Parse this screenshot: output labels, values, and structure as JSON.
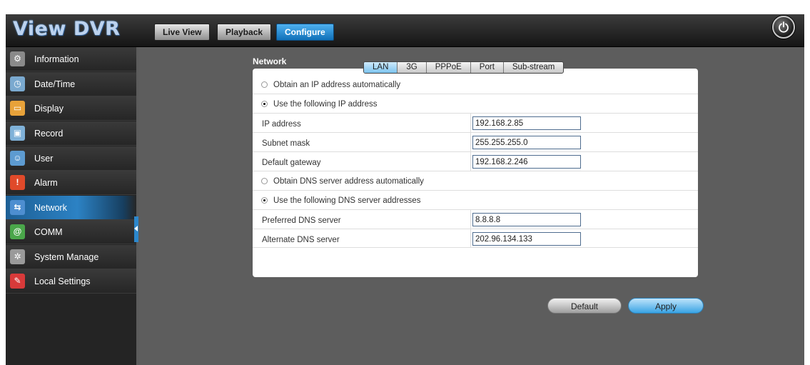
{
  "app": {
    "logo": "View DVR"
  },
  "topnav": {
    "live_view": "Live View",
    "playback": "Playback",
    "configure": "Configure"
  },
  "sidebar": {
    "items": [
      {
        "label": "Information",
        "icon": "gear-icon",
        "color": "#8a8a8a"
      },
      {
        "label": "Date/Time",
        "icon": "clock-icon",
        "color": "#7aa9cf"
      },
      {
        "label": "Display",
        "icon": "monitor-icon",
        "color": "#e8a23a"
      },
      {
        "label": "Record",
        "icon": "record-icon",
        "color": "#7fb1d8"
      },
      {
        "label": "User",
        "icon": "user-icon",
        "color": "#5d9bd1"
      },
      {
        "label": "Alarm",
        "icon": "alarm-icon",
        "color": "#e04a2a"
      },
      {
        "label": "Network",
        "icon": "network-icon",
        "color": "#4d8ed0"
      },
      {
        "label": "COMM",
        "icon": "at-icon",
        "color": "#4aa64a"
      },
      {
        "label": "System Manage",
        "icon": "system-icon",
        "color": "#9a9a9a"
      },
      {
        "label": "Local Settings",
        "icon": "local-settings-icon",
        "color": "#d83a3a"
      }
    ]
  },
  "main": {
    "section_title": "Network",
    "subtabs": [
      "LAN",
      "3G",
      "PPPoE",
      "Port",
      "Sub-stream"
    ],
    "form": {
      "obtain_ip_auto": "Obtain an IP address automatically",
      "use_following_ip": "Use the following IP address",
      "ip_address_label": "IP address",
      "ip_address_value": "192.168.2.85",
      "subnet_mask_label": "Subnet mask",
      "subnet_mask_value": "255.255.255.0",
      "gateway_label": "Default gateway",
      "gateway_value": "192.168.2.246",
      "obtain_dns_auto": "Obtain DNS server address automatically",
      "use_following_dns": "Use the following DNS server addresses",
      "preferred_dns_label": "Preferred DNS server",
      "preferred_dns_value": "8.8.8.8",
      "alternate_dns_label": "Alternate DNS server",
      "alternate_dns_value": "202.96.134.133"
    },
    "buttons": {
      "default": "Default",
      "apply": "Apply"
    }
  }
}
